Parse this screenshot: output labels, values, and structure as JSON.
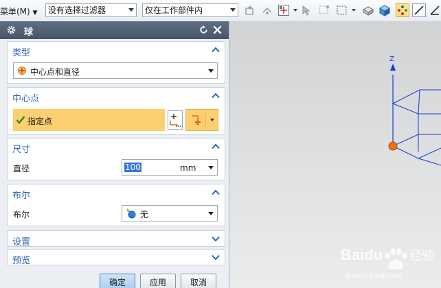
{
  "toolbar": {
    "menu_label": "菜单(M)",
    "filter_value": "没有选择过滤器",
    "scope_value": "仅在工作部件内",
    "icons": [
      "snap-icon",
      "snap-arrow-icon",
      "point-dialog-icon",
      "selection-icon",
      "box-select-icon",
      "brush-icon",
      "solid-icon",
      "shaded-cube-icon",
      "point-dots-icon",
      "line-icon",
      "angle-icon"
    ]
  },
  "dialog": {
    "title": "球",
    "type_section": {
      "title": "类型",
      "value": "中心点和直径"
    },
    "center_section": {
      "title": "中心点",
      "select_label": "指定点"
    },
    "size_section": {
      "title": "尺寸",
      "diameter_label": "直径",
      "diameter_value": "100",
      "unit": "mm"
    },
    "boolean_section": {
      "title": "布尔",
      "label": "布尔",
      "value": "无"
    },
    "settings_section": {
      "title": "设置"
    },
    "preview_section": {
      "title": "预览"
    },
    "buttons": {
      "ok": "确定",
      "apply": "应用",
      "cancel": "取消"
    }
  },
  "viewport": {
    "axis_label": "Z",
    "wire_color": "#1a3bd1",
    "point_color": "#e8711a"
  },
  "watermark": {
    "brand": "Baidu",
    "text": "经验",
    "url": "jingyan.baidu.com"
  }
}
